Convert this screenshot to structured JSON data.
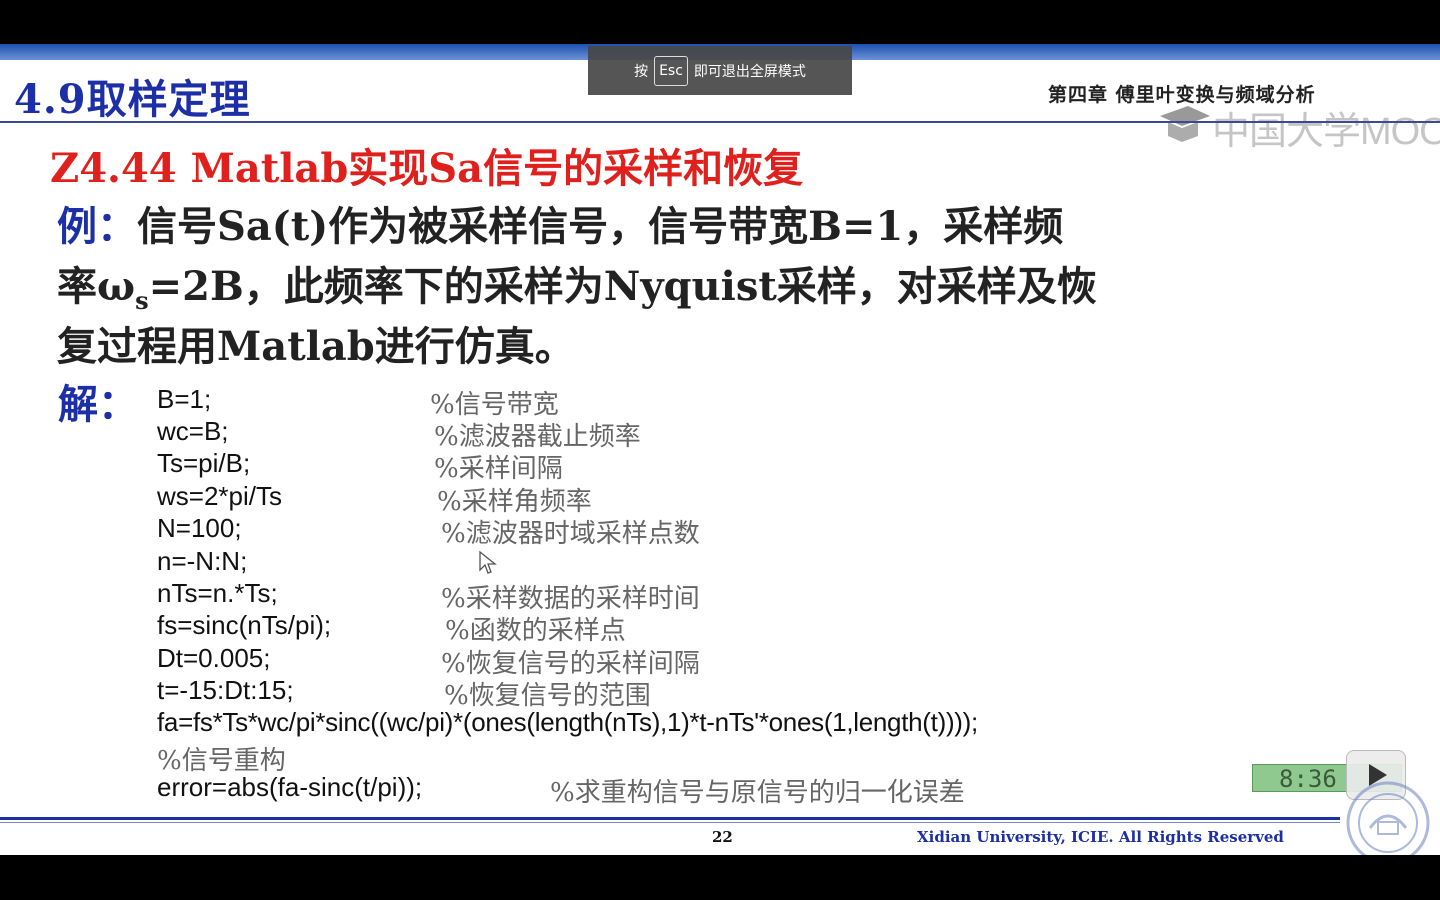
{
  "slide": {
    "section_title": "4.9取样定理",
    "chapter_title": "第四章 傅里叶变换与频域分析",
    "watermark_text": "中国大学MOOC",
    "subtitle": "Z4.44 Matlab实现Sa信号的采样和恢复",
    "example": {
      "label": "例：",
      "line1": "信号Sa(t)作为被采样信号，信号带宽B=1，采样频",
      "line2_pre": "率ω",
      "line2_sub": "s",
      "line2_post": "=2B，此频率下的采样为Nyquist采样，对采样及恢",
      "line3": "复过程用Matlab进行仿真。"
    },
    "solution_label": "解：",
    "code_lines": [
      {
        "code": "B=1;",
        "comment": "%信号带宽"
      },
      {
        "code": "wc=B;",
        "comment": "%滤波器截止频率"
      },
      {
        "code": "Ts=pi/B;",
        "comment": "%采样间隔"
      },
      {
        "code": "ws=2*pi/Ts",
        "comment": "%采样角频率"
      },
      {
        "code": "N=100;",
        "comment": "%滤波器时域采样点数"
      },
      {
        "code": "n=-N:N;",
        "comment": ""
      },
      {
        "code": "nTs=n.*Ts;",
        "comment": "%采样数据的采样时间"
      },
      {
        "code": "fs=sinc(nTs/pi);",
        "comment": "%函数的采样点"
      },
      {
        "code": "Dt=0.005;",
        "comment": "%恢复信号的采样间隔"
      },
      {
        "code": "t=-15:Dt:15;",
        "comment": "%恢复信号的范围"
      },
      {
        "code": "fa=fs*Ts*wc/pi*sinc((wc/pi)*(ones(length(nTs),1)*t-nTs'*ones(1,length(t))));",
        "comment": ""
      },
      {
        "code": "%信号重构",
        "comment": ""
      },
      {
        "code": "error=abs(fa-sinc(t/pi));",
        "comment": "%求重构信号与原信号的归一化误差"
      }
    ],
    "page_number": "22",
    "copyright": "Xidian University, ICIE. All Rights Reserved"
  },
  "player": {
    "time_badge": "8:36"
  },
  "esc_tooltip": {
    "prefix": "按",
    "key": "Esc",
    "suffix": "即可退出全屏模式"
  },
  "colors": {
    "title_blue": "#1d2fa6",
    "subtitle_red": "#e0201c",
    "band_blue": "#1c4fb0"
  },
  "icons": [
    "mouse-cursor-icon",
    "play-icon",
    "university-seal-icon",
    "mooc-logo-icon"
  ]
}
